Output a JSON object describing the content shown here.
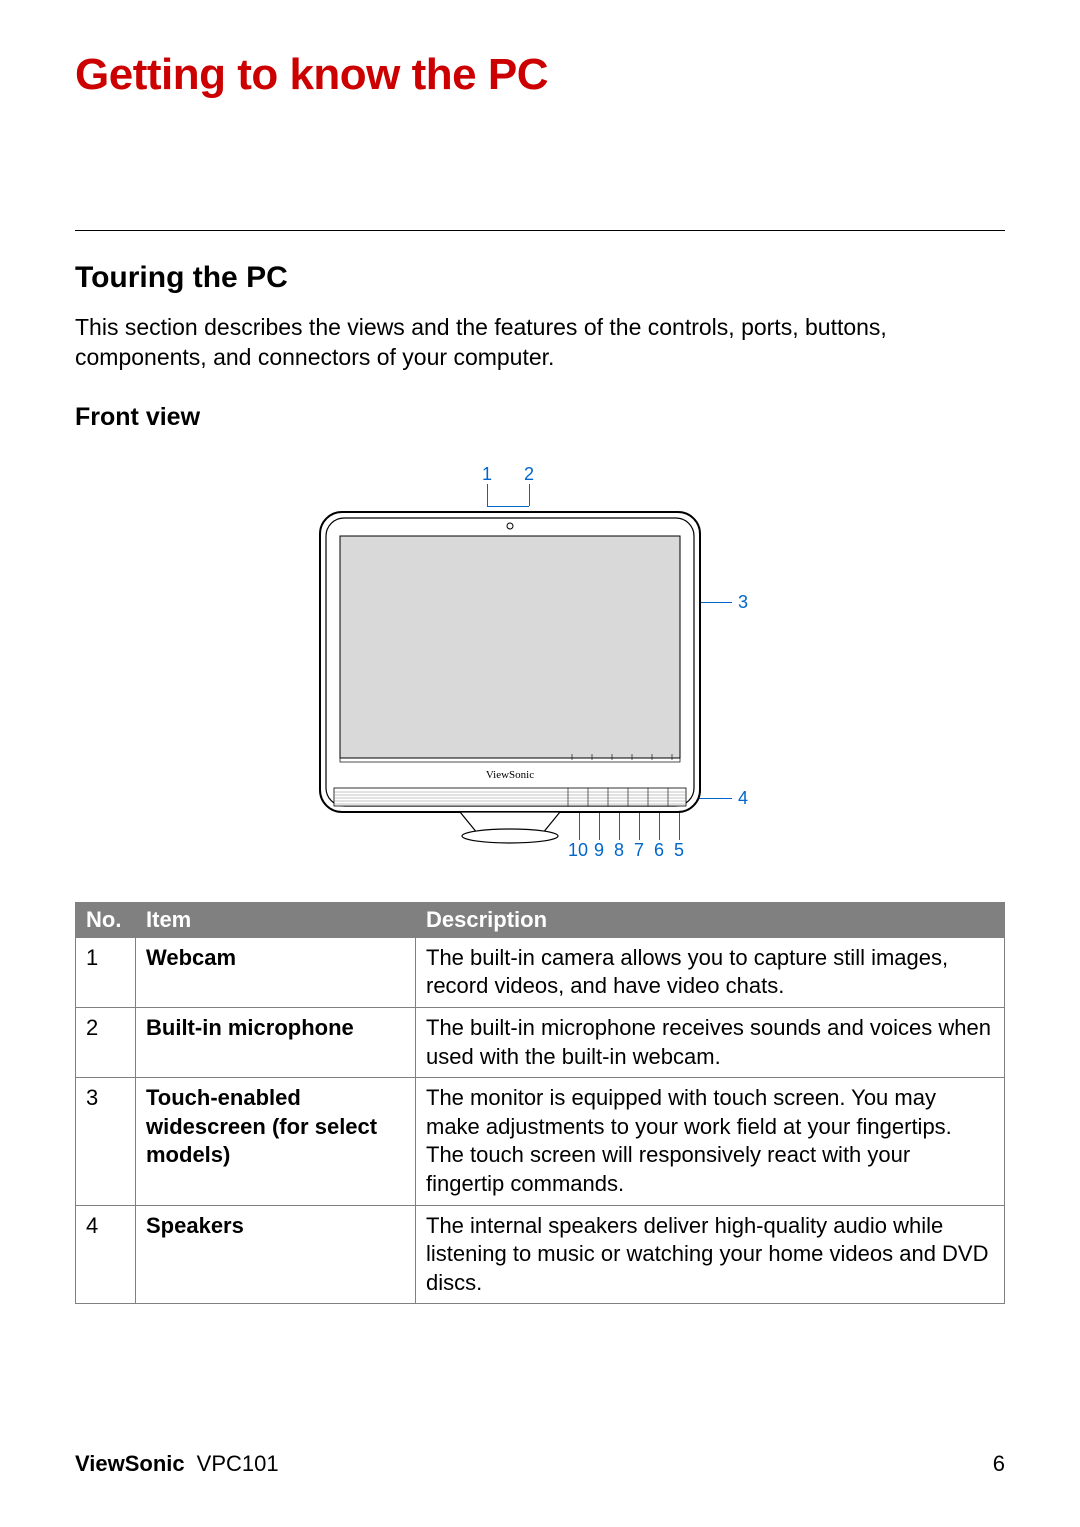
{
  "title": "Getting to know the PC",
  "section": {
    "heading": "Touring the PC",
    "description": "This section describes the views and the features of the controls, ports, buttons, components, and connectors of your computer.",
    "sub": "Front view"
  },
  "diagram": {
    "brand": "ViewSonic",
    "labels": {
      "l1": "1",
      "l2": "2",
      "l3": "3",
      "l4": "4",
      "l5": "5",
      "l6": "6",
      "l7": "7",
      "l8": "8",
      "l9": "9",
      "l10": "10"
    }
  },
  "table": {
    "headers": {
      "no": "No.",
      "item": "Item",
      "desc": "Description"
    },
    "rows": [
      {
        "no": "1",
        "item": "Webcam",
        "desc": "The built-in camera allows you to capture still images, record videos, and have video chats."
      },
      {
        "no": "2",
        "item": "Built-in microphone",
        "desc": "The built-in microphone receives sounds and voices when used with the built-in webcam."
      },
      {
        "no": "3",
        "item": "Touch-enabled widescreen (for select models)",
        "desc": "The monitor is equipped with touch screen. You may make adjustments to your work field at your fingertips. The touch screen will responsively react with your fingertip commands."
      },
      {
        "no": "4",
        "item": "Speakers",
        "desc": "The internal speakers deliver high-quality audio while listening to music or watching your home videos and DVD discs."
      }
    ]
  },
  "footer": {
    "brand": "ViewSonic",
    "model": "VPC101",
    "page": "6"
  }
}
